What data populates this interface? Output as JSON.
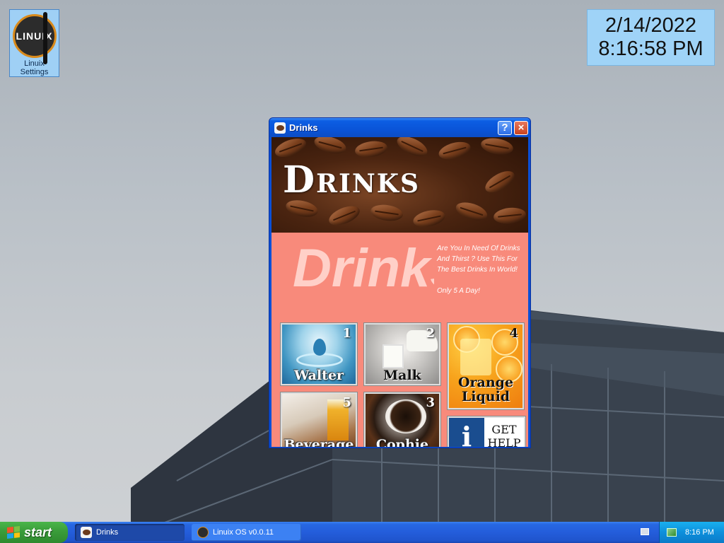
{
  "desktop": {
    "icon_label_line1": "Linuix",
    "icon_label_line2": "Settings",
    "icon_logo_text": "LINUIX"
  },
  "clock": {
    "date": "2/14/2022",
    "time": "8:16:58 PM"
  },
  "window": {
    "title": "Drinks",
    "help_label": "?",
    "close_label": "×",
    "banner_title": "Drinks",
    "big_word": "Drinks",
    "promo_text": "Are You In Need Of Drinks And Thirst ? Use This For The Best Drinks In World!",
    "promo_tag": "Only 5 A Day!",
    "tiles": [
      {
        "num": "1",
        "label": "Walter"
      },
      {
        "num": "2",
        "label": "Malk"
      },
      {
        "num": "4",
        "label_line1": "Orange",
        "label_line2": "Liquid"
      },
      {
        "num": "5",
        "label": "Beverage"
      },
      {
        "num": "3",
        "label": "Cophie"
      }
    ],
    "help_tile": {
      "icon": "i",
      "line1": "GET",
      "line2": "HELP"
    }
  },
  "taskbar": {
    "start_label": "start",
    "tasks": [
      {
        "label": "Drinks",
        "active": true
      },
      {
        "label": "Linuix OS v0.0.11",
        "active": false
      }
    ],
    "tray_time": "8:16 PM"
  },
  "colors": {
    "client_bg": "#f88a7b",
    "title_blue": "#0a54d8",
    "clock_bg": "#9fd3f7",
    "start_green": "#3a9c3a"
  }
}
